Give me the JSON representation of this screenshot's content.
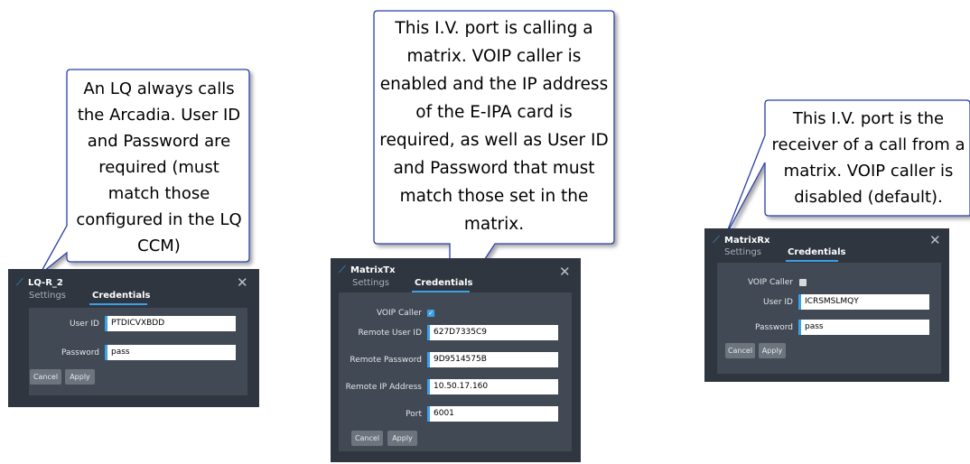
{
  "callouts": {
    "left": "An LQ always calls\nthe Arcadia. User ID\nand Password are\nrequired (must\nmatch those\nconfigured in the LQ\nCCM)",
    "middle": "This I.V. port is calling a\nmatrix. VOIP caller is\nenabled and the IP address\nof the E-IPA card is\nrequired, as well as User ID\nand Password that must\nmatch those set in the\nmatrix.",
    "right": "This I.V. port is the\nreceiver of a call from a\nmatrix. VOIP caller is\ndisabled (default)."
  },
  "panel_lq": {
    "title": "LQ-R_2",
    "tab_settings": "Settings",
    "tab_credentials": "Credentials",
    "user_id_label": "User ID",
    "user_id_value": "PTDICVXBDD",
    "password_label": "Password",
    "password_value": "pass",
    "cancel": "Cancel",
    "apply": "Apply"
  },
  "panel_tx": {
    "title": "MatrixTx",
    "tab_settings": "Settings",
    "tab_credentials": "Credentials",
    "voip_label": "VOIP Caller",
    "voip_checked": true,
    "remote_user_label": "Remote User ID",
    "remote_user_value": "627D7335C9",
    "remote_pass_label": "Remote Password",
    "remote_pass_value": "9D9514575B",
    "remote_ip_label": "Remote IP Address",
    "remote_ip_value": "10.50.17.160",
    "port_label": "Port",
    "port_value": "6001",
    "cancel": "Cancel",
    "apply": "Apply"
  },
  "panel_rx": {
    "title": "MatrixRx",
    "tab_settings": "Settings",
    "tab_credentials": "Credentials",
    "voip_label": "VOIP Caller",
    "voip_checked": false,
    "user_id_label": "User ID",
    "user_id_value": "ICRSMSLMQY",
    "password_label": "Password",
    "password_value": "pass",
    "cancel": "Cancel",
    "apply": "Apply"
  },
  "colors": {
    "accent": "#3aa0e8",
    "callout_border": "#2c3fa8",
    "panel_bg": "#2f3640",
    "panel_body": "#414954"
  }
}
